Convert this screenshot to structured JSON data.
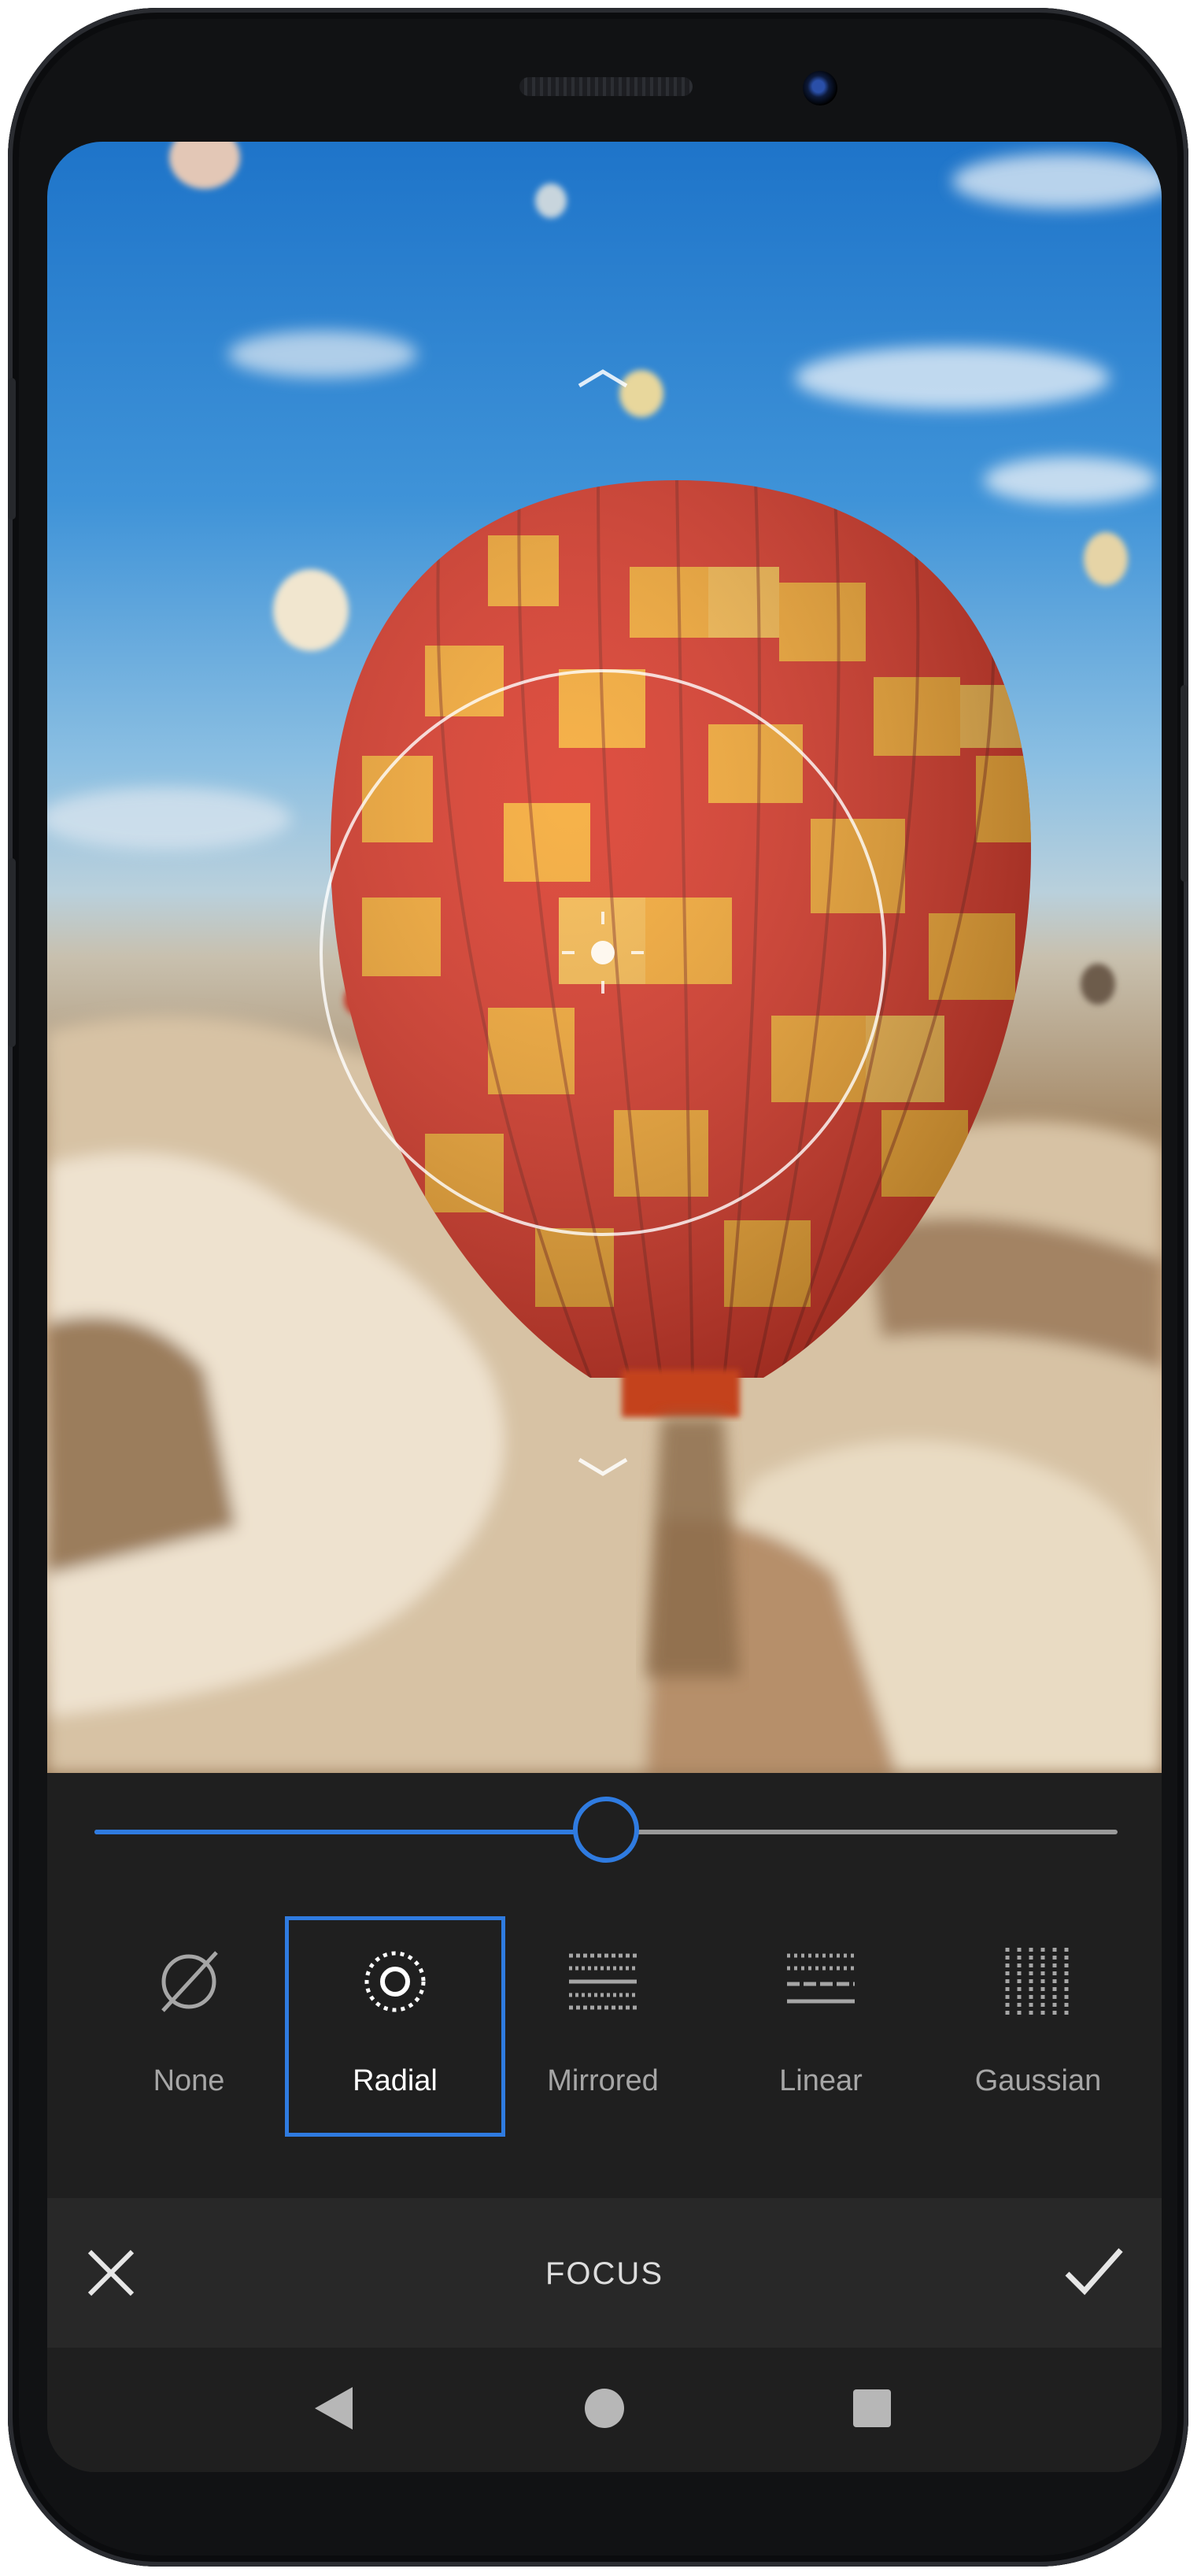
{
  "screen": {
    "tool_title": "FOCUS"
  },
  "slider": {
    "value": 0.5
  },
  "filters": [
    {
      "label": "None",
      "icon": "none-icon",
      "selected": false
    },
    {
      "label": "Radial",
      "icon": "radial-icon",
      "selected": true
    },
    {
      "label": "Mirrored",
      "icon": "mirrored-icon",
      "selected": false
    },
    {
      "label": "Linear",
      "icon": "linear-icon",
      "selected": false
    },
    {
      "label": "Gaussian",
      "icon": "gaussian-icon",
      "selected": false
    }
  ],
  "actions": {
    "cancel_icon": "close-icon",
    "confirm_icon": "check-icon"
  },
  "navigation": {
    "back_icon": "back-triangle-icon",
    "home_icon": "home-circle-icon",
    "recents_icon": "recents-square-icon"
  },
  "colors": {
    "accent": "#2f7be0",
    "panel_background": "#1f1f1f",
    "action_bar_background": "#282828"
  }
}
